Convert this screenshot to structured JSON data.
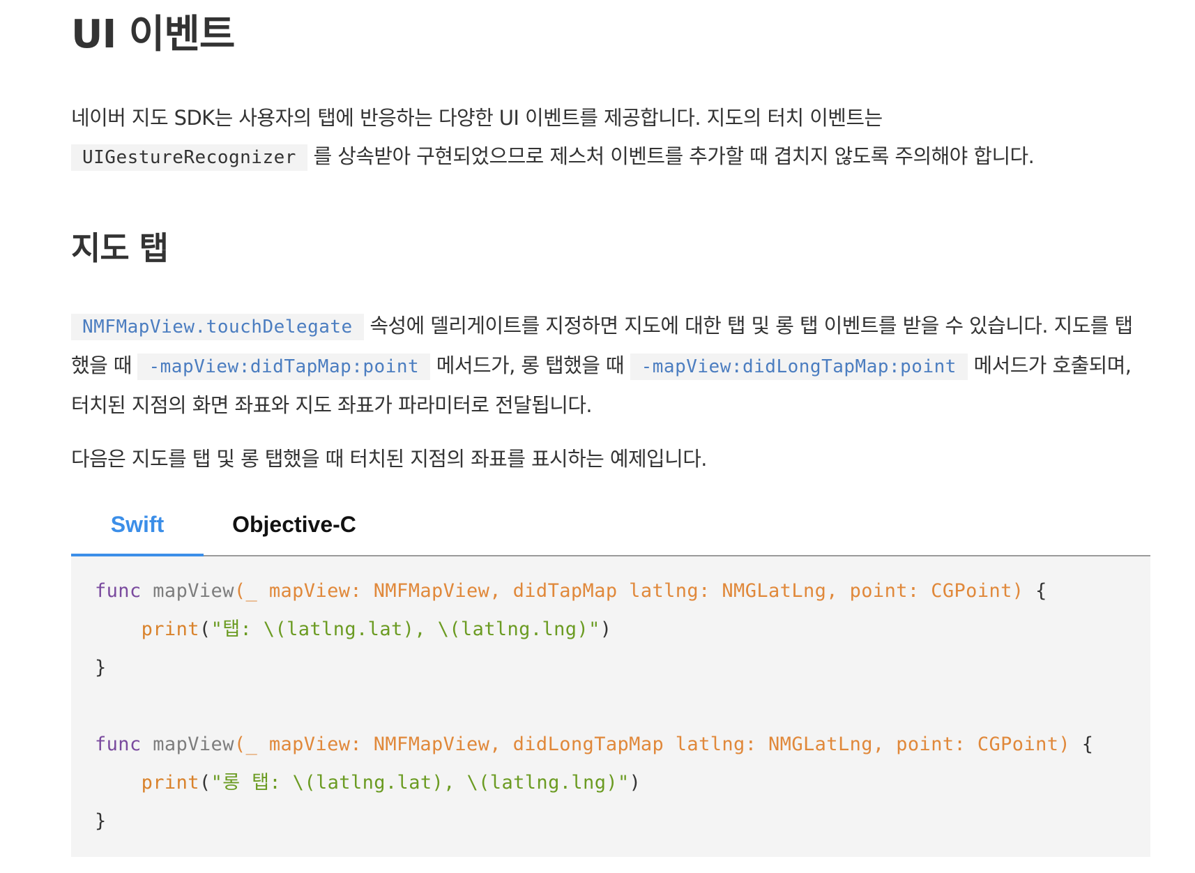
{
  "heading": "UI 이벤트",
  "intro": {
    "text1": "네이버 지도 SDK는 사용자의 탭에 반응하는 다양한 UI 이벤트를 제공합니다. 지도의 터치 이벤트는",
    "code": "UIGestureRecognizer",
    "text2": "를 상속받아 구현되었으므로 제스처 이벤트를 추가할 때 겹치지 않도록 주의해야 합니다."
  },
  "section": {
    "title": "지도 탭",
    "p1": {
      "code1": "NMFMapView.touchDelegate",
      "text1": "속성에 델리게이트를 지정하면 지도에 대한 탭 및 롱 탭 이벤트를 받을 수 있습니다. 지도를 탭했을 때",
      "code2": "-mapView:didTapMap:point",
      "text2": "메서드가, 롱 탭했을 때",
      "code3": "-mapView:didLongTapMap:point",
      "text3": "메서드가 호출되며, 터치된 지점의 화면 좌표와 지도 좌표가 파라미터로 전달됩니다."
    },
    "p2": "다음은 지도를 탭 및 롱 탭했을 때 터치된 지점의 좌표를 표시하는 예제입니다."
  },
  "tabs": [
    {
      "label": "Swift",
      "active": true
    },
    {
      "label": "Objective-C",
      "active": false
    }
  ],
  "code": {
    "block1": {
      "kw": "func",
      "name": " mapView",
      "sig": "(_ mapView: NMFMapView, didTapMap latlng: NMGLatLng, point: CGPoint)",
      "open": " {",
      "indent": "    ",
      "call": "print",
      "lparen": "(",
      "str": "\"탭: \\(latlng.lat), \\(latlng.lng)\"",
      "rparen": ")",
      "close": "}"
    },
    "block2": {
      "kw": "func",
      "name": " mapView",
      "sig": "(_ mapView: NMFMapView, didLongTapMap latlng: NMGLatLng, point: CGPoint)",
      "open": " {",
      "indent": "    ",
      "call": "print",
      "lparen": "(",
      "str": "\"롱 탭: \\(latlng.lat), \\(latlng.lng)\"",
      "rparen": ")",
      "close": "}"
    }
  },
  "colors": {
    "activeTab": "#3b8ee8",
    "keyword": "#7a4a9e",
    "signature": "#e0883a",
    "string": "#6b9b22",
    "inlineCode": "#4b7dc0"
  }
}
